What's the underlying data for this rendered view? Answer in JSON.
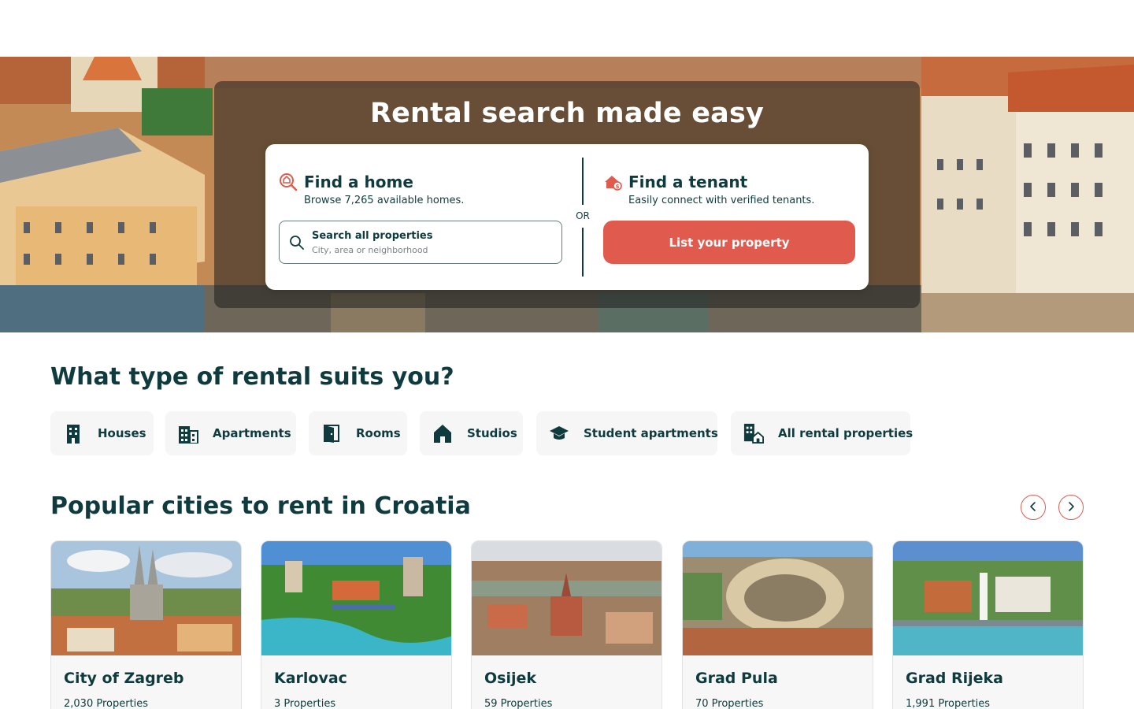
{
  "hero": {
    "title": "Rental search made easy",
    "find_home": {
      "title": "Find a home",
      "subtitle": "Browse 7,265 available homes.",
      "search_label": "Search all properties",
      "search_placeholder": "City, area or neighborhood"
    },
    "or_label": "OR",
    "find_tenant": {
      "title": "Find a tenant",
      "subtitle": "Easily connect with verified tenants.",
      "button_label": "List your property"
    }
  },
  "rental_types": {
    "title": "What type of rental suits you?",
    "items": [
      {
        "label": "Houses",
        "icon": "house-building-icon"
      },
      {
        "label": "Apartments",
        "icon": "apartment-building-icon"
      },
      {
        "label": "Rooms",
        "icon": "door-icon"
      },
      {
        "label": "Studios",
        "icon": "home-icon"
      },
      {
        "label": "Student apartments",
        "icon": "graduation-cap-icon"
      },
      {
        "label": "All rental properties",
        "icon": "buildings-home-icon"
      }
    ]
  },
  "cities": {
    "title": "Popular cities to rent in Croatia",
    "items": [
      {
        "name": "City of Zagreb",
        "count": "2,030 Properties"
      },
      {
        "name": "Karlovac",
        "count": "3 Properties"
      },
      {
        "name": "Osijek",
        "count": "59 Properties"
      },
      {
        "name": "Grad Pula",
        "count": "70 Properties"
      },
      {
        "name": "Grad Rijeka",
        "count": "1,991 Properties"
      }
    ]
  },
  "colors": {
    "accent": "#e05a4e",
    "text": "#0f3b3e",
    "chip_bg": "#f6f6f6"
  }
}
